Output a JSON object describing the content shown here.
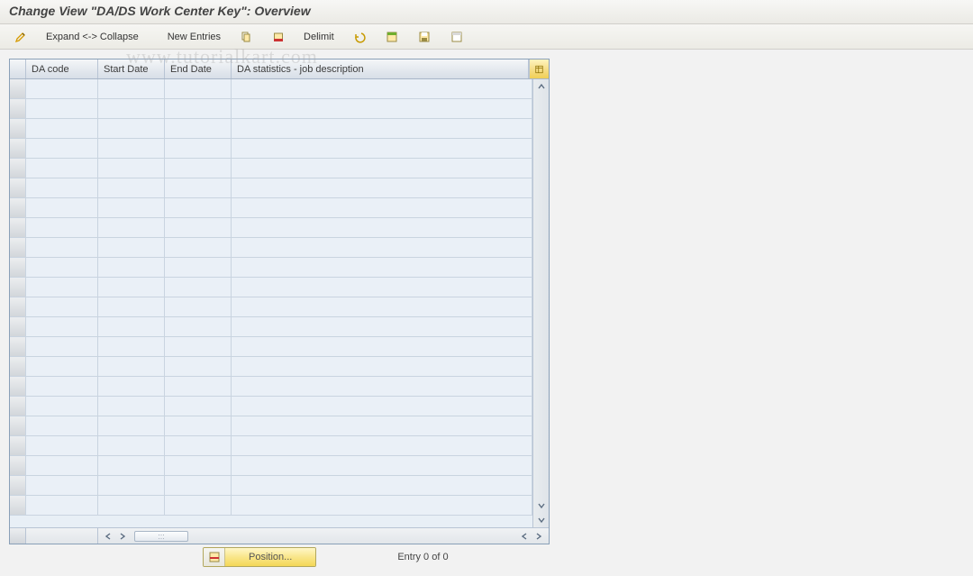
{
  "title": "Change View \"DA/DS Work Center Key\": Overview",
  "toolbar": {
    "expand_collapse_label": "Expand <-> Collapse",
    "new_entries_label": "New Entries",
    "delimit_label": "Delimit",
    "icons": {
      "pencil": "pencil-icon",
      "copy": "copy-icon",
      "delete": "delete-icon",
      "undo": "undo-icon",
      "select_all": "select-all-icon",
      "save": "save-icon",
      "deselect_all": "deselect-all-icon"
    }
  },
  "table": {
    "columns": [
      {
        "label": "DA code"
      },
      {
        "label": "Start Date"
      },
      {
        "label": "End Date"
      },
      {
        "label": "DA statistics - job description"
      }
    ],
    "empty_row_count": 22
  },
  "footer": {
    "position_button_label": "Position...",
    "entry_label": "Entry 0 of 0"
  },
  "watermark": "www.tutorialkart.com"
}
